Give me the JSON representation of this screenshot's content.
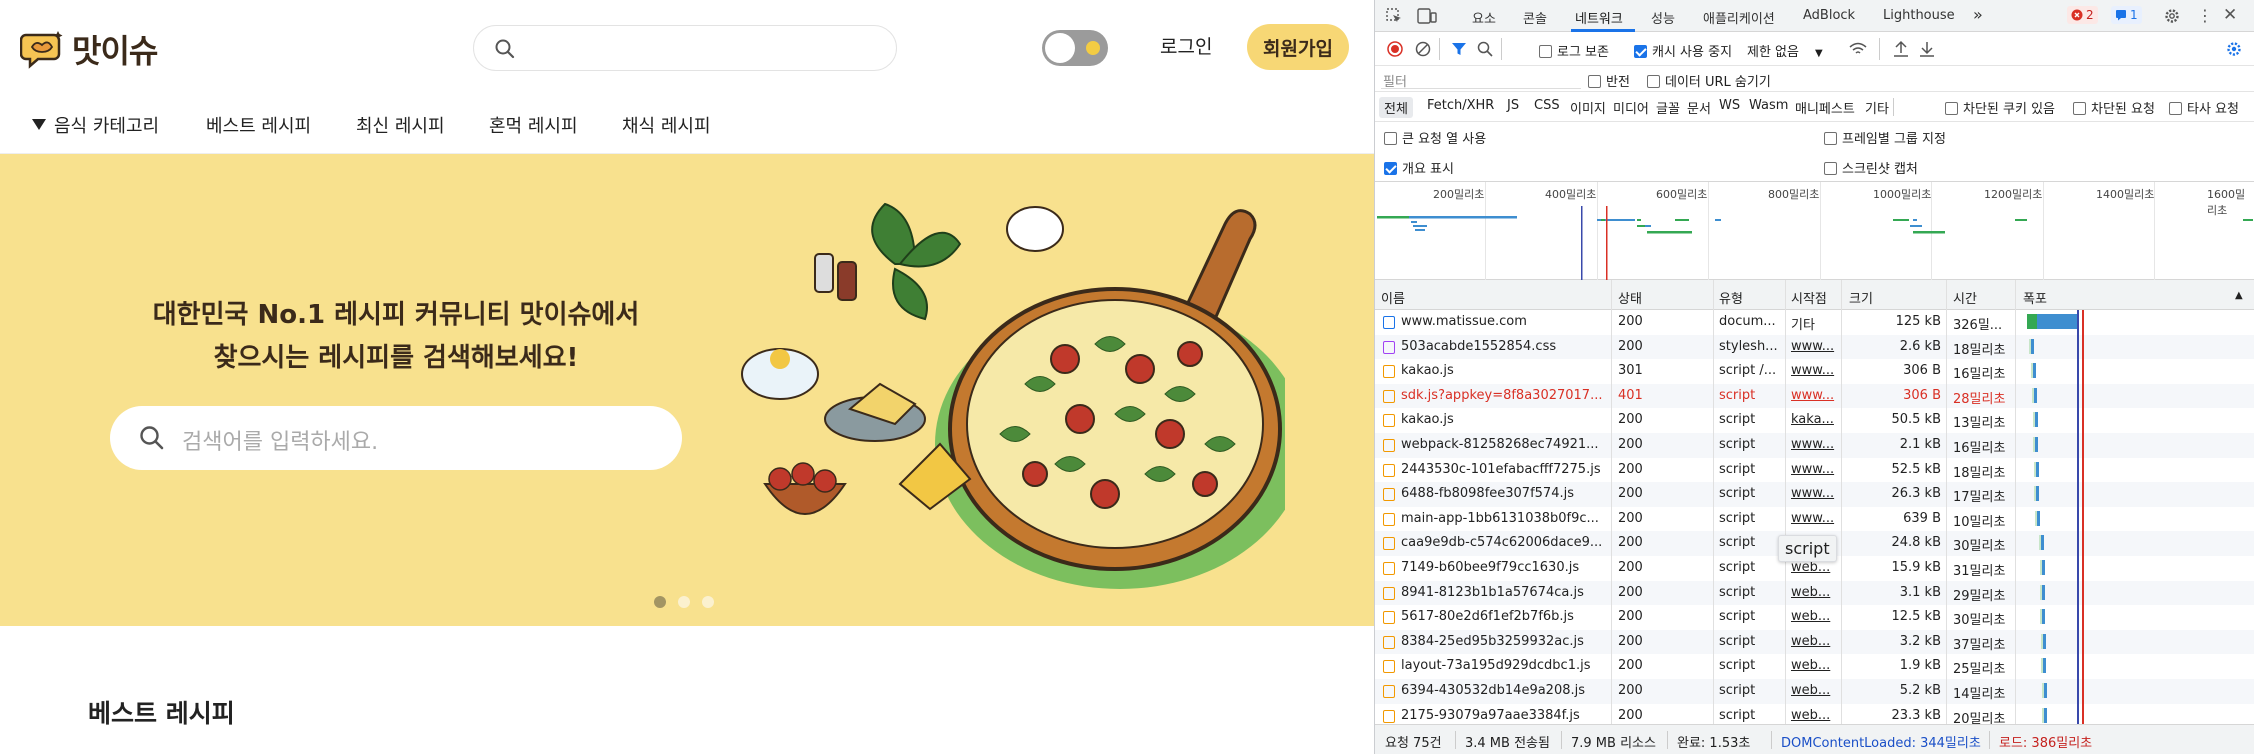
{
  "site": {
    "logo_text": "맛이슈",
    "login_label": "로그인",
    "signup_label": "회원가입",
    "nav": {
      "category_label": "음식 카테고리",
      "items": [
        "베스트 레시피",
        "최신 레시피",
        "혼먹 레시피",
        "채식 레시피"
      ]
    },
    "hero": {
      "line1": "대한민국 No.1 레시피 커뮤니티 맛이슈에서",
      "line2": "찾으시는 레시피를 검색해보세요!",
      "search_placeholder": "검색어를 입력하세요.",
      "carousel_active": 1,
      "carousel_count": 3
    },
    "section_title": "베스트 레시피",
    "colors": {
      "accent": "#f7d775",
      "hero_bg": "#f8e18e",
      "brand_text": "#3b2a1a"
    }
  },
  "devtools": {
    "tabs": [
      "요소",
      "콘솔",
      "네트워크",
      "성능",
      "애플리케이션",
      "AdBlock",
      "Lighthouse"
    ],
    "active_tab": "네트워크",
    "error_count": "2",
    "message_count": "1",
    "toolbar": {
      "preserve_log": "로그 보존",
      "disable_cache": "캐시 사용 중지",
      "throttle": "제한 없음"
    },
    "filter": {
      "placeholder": "필터",
      "invert": "반전",
      "hide_data_urls": "데이터 URL 숨기기"
    },
    "type_filters": [
      "전체",
      "Fetch/XHR",
      "JS",
      "CSS",
      "이미지",
      "미디어",
      "글꼴",
      "문서",
      "WS",
      "Wasm",
      "매니페스트",
      "기타"
    ],
    "type_checks": [
      "차단된 쿠키 있음",
      "차단된 요청",
      "타사 요청"
    ],
    "options": {
      "big_rows": "큰 요청 열 사용",
      "group_by_frame": "프레임별 그룹 지정",
      "overview": "개요 표시",
      "screenshots": "스크린샷 캡처"
    },
    "timeline_ticks": [
      "200밀리초",
      "400밀리초",
      "600밀리초",
      "800밀리초",
      "1000밀리초",
      "1200밀리초",
      "1400밀리초",
      "1600밀리초"
    ],
    "columns": [
      "이름",
      "상태",
      "유형",
      "시작점",
      "크기",
      "시간",
      "폭포"
    ],
    "requests": [
      {
        "name": "www.matissue.com",
        "status": "200",
        "type": "docum...",
        "initiator": "기타",
        "size": "125 kB",
        "time": "326밀...",
        "kind": "doc"
      },
      {
        "name": "503acabde1552854.css",
        "status": "200",
        "type": "stylesh...",
        "initiator": "www...",
        "size": "2.6 kB",
        "time": "18밀리초",
        "kind": "css"
      },
      {
        "name": "kakao.js",
        "status": "301",
        "type": "script /...",
        "initiator": "www...",
        "size": "306 B",
        "time": "16밀리초",
        "kind": "js"
      },
      {
        "name": "sdk.js?appkey=8f8a3027017...",
        "status": "401",
        "type": "script",
        "initiator": "www...",
        "size": "306 B",
        "time": "28밀리초",
        "kind": "js",
        "error": true
      },
      {
        "name": "kakao.js",
        "status": "200",
        "type": "script",
        "initiator": "kaka...",
        "size": "50.5 kB",
        "time": "13밀리초",
        "kind": "js"
      },
      {
        "name": "webpack-81258268ec74921...",
        "status": "200",
        "type": "script",
        "initiator": "www...",
        "size": "2.1 kB",
        "time": "16밀리초",
        "kind": "js"
      },
      {
        "name": "2443530c-101efabacfff7275.js",
        "status": "200",
        "type": "script",
        "initiator": "www...",
        "size": "52.5 kB",
        "time": "18밀리초",
        "kind": "js"
      },
      {
        "name": "6488-fb8098fee307f574.js",
        "status": "200",
        "type": "script",
        "initiator": "www...",
        "size": "26.3 kB",
        "time": "17밀리초",
        "kind": "js"
      },
      {
        "name": "main-app-1bb6131038b0f9c...",
        "status": "200",
        "type": "script",
        "initiator": "www...",
        "size": "639 B",
        "time": "10밀리초",
        "kind": "js"
      },
      {
        "name": "caa9e9db-c574c62006dace9...",
        "status": "200",
        "type": "script",
        "initiator": "",
        "size": "24.8 kB",
        "time": "30밀리초",
        "kind": "js"
      },
      {
        "name": "7149-b60bee9f79cc1630.js",
        "status": "200",
        "type": "script",
        "initiator": "web...",
        "size": "15.9 kB",
        "time": "31밀리초",
        "kind": "js"
      },
      {
        "name": "8941-8123b1b1a57674ca.js",
        "status": "200",
        "type": "script",
        "initiator": "web...",
        "size": "3.1 kB",
        "time": "29밀리초",
        "kind": "js"
      },
      {
        "name": "5617-80e2d6f1ef2b7f6b.js",
        "status": "200",
        "type": "script",
        "initiator": "web...",
        "size": "12.5 kB",
        "time": "30밀리초",
        "kind": "js"
      },
      {
        "name": "8384-25ed95b3259932ac.js",
        "status": "200",
        "type": "script",
        "initiator": "web...",
        "size": "3.2 kB",
        "time": "37밀리초",
        "kind": "js"
      },
      {
        "name": "layout-73a195d929dcdbc1.js",
        "status": "200",
        "type": "script",
        "initiator": "web...",
        "size": "1.9 kB",
        "time": "25밀리초",
        "kind": "js"
      },
      {
        "name": "6394-430532db14e9a208.js",
        "status": "200",
        "type": "script",
        "initiator": "web...",
        "size": "5.2 kB",
        "time": "14밀리초",
        "kind": "js"
      },
      {
        "name": "2175-93079a97aae3384f.js",
        "status": "200",
        "type": "script",
        "initiator": "web...",
        "size": "23.3 kB",
        "time": "20밀리초",
        "kind": "js"
      }
    ],
    "tooltip": "script",
    "statusbar": {
      "requests": "요청 75건",
      "transferred": "3.4 MB 전송됨",
      "resources": "7.9 MB 리소스",
      "finish": "완료: 1.53초",
      "dcl": "DOMContentLoaded: 344밀리초",
      "load": "로드: 386밀리초"
    }
  }
}
